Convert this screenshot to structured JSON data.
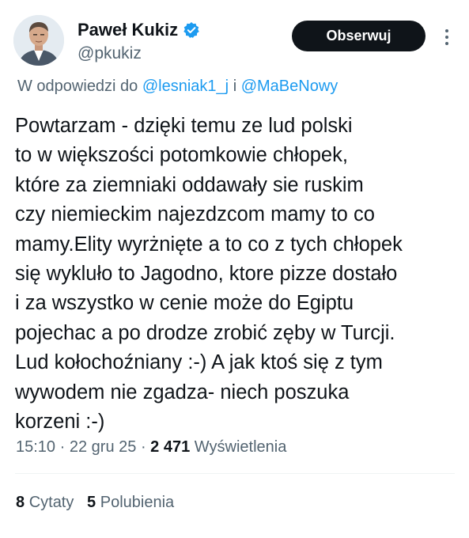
{
  "author": {
    "display_name": "Paweł Kukiz",
    "handle": "@pkukiz",
    "verified_icon": "verified-badge-icon",
    "avatar": "profile-photo"
  },
  "header": {
    "follow_label": "Obserwuj",
    "more_icon": "more-vertical-icon"
  },
  "reply_context": {
    "prefix": "W odpowiedzi do",
    "mention_1": "@lesniak1_j",
    "conjunction": "i",
    "mention_2": "@MaBeNowy"
  },
  "tweet": {
    "lines": [
      "Powtarzam - dzięki temu ze lud polski",
      "to w większości potomkowie chłopek,",
      "które za  ziemniaki oddawały sie ruskim",
      "czy niemieckim najezdzcom mamy to co",
      "mamy.Elity wyrżnięte a to co z tych chłopek",
      "się wykluło to Jagodno, ktore pizze dostało",
      "i za wszystko w cenie może do Egiptu",
      "pojechac a po drodze zrobić zęby w Turcji.",
      "Lud kołochoźniany :-) A jak ktoś się z tym",
      "wywodem nie zgadza- niech  poszuka",
      "korzeni :-)"
    ]
  },
  "meta": {
    "time": "15:10",
    "separator": "·",
    "date": "22 gru 25",
    "views_count": "2 471",
    "views_label": "Wyświetlenia"
  },
  "engagement": {
    "quotes_count": "8",
    "quotes_label": "Cytaty",
    "likes_count": "5",
    "likes_label": "Polubienia"
  },
  "colors": {
    "text": "#0f1419",
    "secondary": "#536471",
    "link": "#1d9bf0",
    "verified": "#1d9bf0",
    "button_bg": "#0f1419"
  }
}
